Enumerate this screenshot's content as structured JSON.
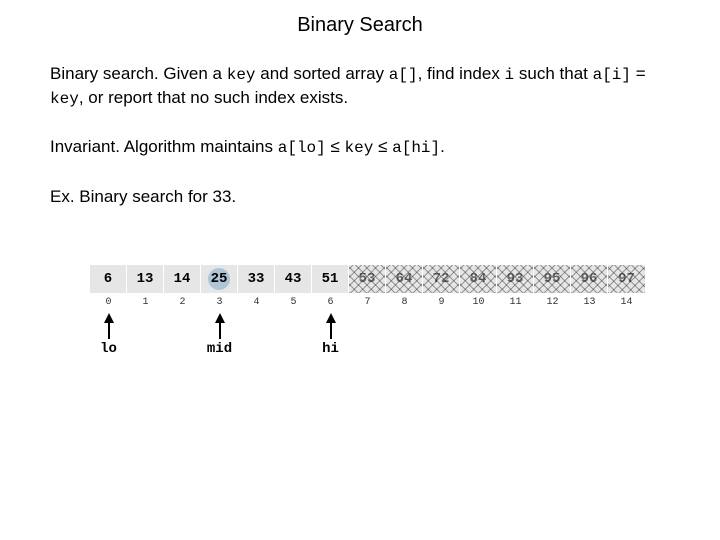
{
  "title": "Binary Search",
  "p1": {
    "lead": "Binary search.",
    "t1": "  Given a ",
    "c1": "key",
    "t2": " and sorted array ",
    "c2": "a[]",
    "t3": ", find index ",
    "c3": "i",
    "t4": " such that ",
    "c4": "a[i]",
    "t5": " = ",
    "c5": "key",
    "t6": ", or report that no such index exists."
  },
  "p2": {
    "lead": "Invariant.",
    "t1": "  Algorithm maintains ",
    "c1": "a[lo]",
    "le1": " ≤ ",
    "c2": "key",
    "le2": " ≤ ",
    "c3": "a[hi]",
    "dot": "."
  },
  "p3": {
    "lead": "Ex.",
    "t1": "  Binary search for 33."
  },
  "cells": [
    "6",
    "13",
    "14",
    "25",
    "33",
    "43",
    "51",
    "53",
    "64",
    "72",
    "84",
    "93",
    "95",
    "96",
    "97"
  ],
  "dim": [
    false,
    false,
    false,
    false,
    false,
    false,
    false,
    true,
    true,
    true,
    true,
    true,
    true,
    true,
    true
  ],
  "midIndex": 3,
  "indices": [
    "0",
    "1",
    "2",
    "3",
    "4",
    "5",
    "6",
    "7",
    "8",
    "9",
    "10",
    "11",
    "12",
    "13",
    "14"
  ],
  "arrows": {
    "lo": {
      "pos": 0,
      "label": "lo"
    },
    "mid": {
      "pos": 3,
      "label": "mid"
    },
    "hi": {
      "pos": 6,
      "label": "hi"
    }
  }
}
